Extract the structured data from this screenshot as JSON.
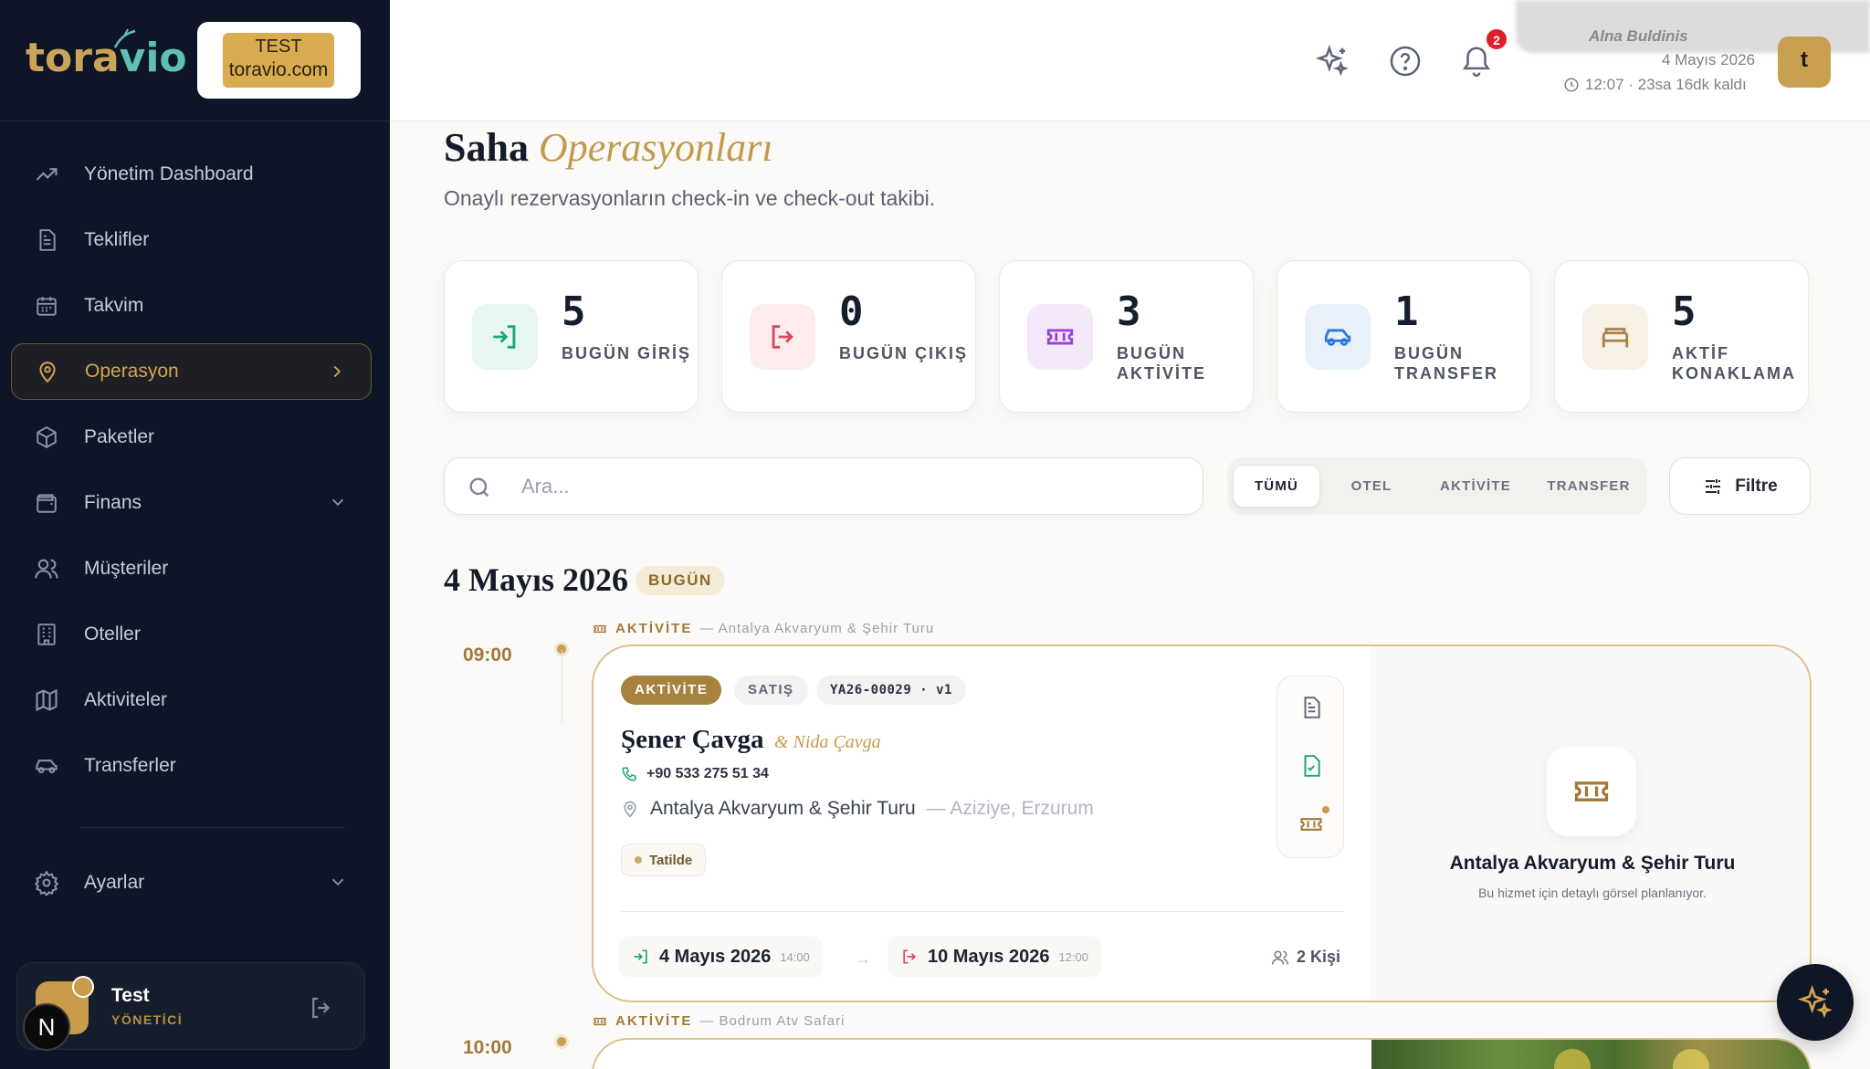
{
  "brand": {
    "logo_prefix": "tora",
    "logo_suffix": "vio",
    "env_label": "TEST",
    "env_domain": "toravio.com"
  },
  "sidebar": {
    "items": [
      {
        "label": "Yönetim Dashboard",
        "icon": "trend-icon"
      },
      {
        "label": "Teklifler",
        "icon": "document-icon"
      },
      {
        "label": "Takvim",
        "icon": "calendar-icon"
      },
      {
        "label": "Operasyon",
        "icon": "map-pin-icon",
        "active": true
      },
      {
        "label": "Paketler",
        "icon": "package-icon"
      },
      {
        "label": "Finans",
        "icon": "wallet-icon"
      },
      {
        "label": "Müşteriler",
        "icon": "users-icon"
      },
      {
        "label": "Oteller",
        "icon": "building-icon"
      },
      {
        "label": "Aktiviteler",
        "icon": "map-icon"
      },
      {
        "label": "Transferler",
        "icon": "car-icon"
      }
    ],
    "settings_label": "Ayarlar",
    "user": {
      "name": "Test",
      "role": "YÖNETİCİ",
      "initial": "N"
    }
  },
  "topbar": {
    "notification_count": "2",
    "user_name": "Alna Buldinis",
    "date": "4 Mayıs 2026",
    "time_left": "12:07 · 23sa 16dk kaldı",
    "avatar_initial": "t"
  },
  "page": {
    "title": "Saha",
    "title_accent": "Operasyonları",
    "subtitle": "Onaylı rezervasyonların check-in ve check-out takibi."
  },
  "stats": [
    {
      "value": "5",
      "label": "BUGÜN GİRİŞ",
      "icon": "login-icon",
      "color": "#1aa57a",
      "bg": "#e8f6f0"
    },
    {
      "value": "0",
      "label": "BUGÜN ÇIKIŞ",
      "icon": "logout-icon",
      "color": "#e0445a",
      "bg": "#fdecee"
    },
    {
      "value": "3",
      "label": "BUGÜN AKTİVİTE",
      "icon": "ticket-icon",
      "color": "#9b3fd6",
      "bg": "#f3e9fb"
    },
    {
      "value": "1",
      "label": "BUGÜN TRANSFER",
      "icon": "car-icon",
      "color": "#2a7ad6",
      "bg": "#e8f1fb"
    },
    {
      "value": "5",
      "label": "AKTİF KONAKLAMA",
      "icon": "bed-icon",
      "color": "#a7834a",
      "bg": "#f7f0e4"
    }
  ],
  "search": {
    "placeholder": "Ara..."
  },
  "tabs": [
    "TÜMÜ",
    "OTEL",
    "AKTİVİTE",
    "TRANSFER"
  ],
  "filter_label": "Filtre",
  "day": {
    "title": "4 Mayıs 2026",
    "badge": "BUGÜN"
  },
  "events": [
    {
      "time": "09:00",
      "kind": "AKTİVİTE",
      "head_name": "— Antalya Akvaryum & Şehir Turu",
      "pills": [
        "AKTİVİTE",
        "SATIŞ",
        "YA26-00029 · v1"
      ],
      "name": "Şener Çavga",
      "companion": "& Nida Çavga",
      "phone": "+90 533 275 51 34",
      "location": "Antalya Akvaryum & Şehir Turu",
      "location_sub": "— Aziziye, Erzurum",
      "tag": "Tatilde",
      "start_date": "4 Mayıs 2026",
      "start_time": "14:00",
      "arrow": "→",
      "end_date": "10 Mayıs 2026",
      "end_time": "12:00",
      "people": "2 Kişi",
      "placeholder_title": "Antalya Akvaryum & Şehir Turu",
      "placeholder_sub": "Bu hizmet için detaylı görsel planlanıyor."
    },
    {
      "time": "10:00",
      "kind": "AKTİVİTE",
      "head_name": "— Bodrum Atv Safari"
    }
  ],
  "colors": {
    "accent": "#c39a4c",
    "sidebar_bg": "#0e1526",
    "card_border": "#dcc18d"
  }
}
